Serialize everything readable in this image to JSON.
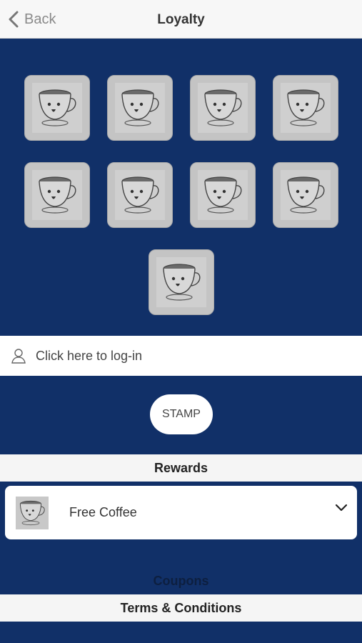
{
  "nav": {
    "back_label": "Back",
    "title": "Loyalty"
  },
  "stamps": {
    "count": 9,
    "icon": "coffee-cup-icon"
  },
  "login": {
    "text": "Click here to log-in",
    "icon": "user-icon"
  },
  "stamp_button": {
    "label": "STAMP"
  },
  "rewards": {
    "header": "Rewards",
    "items": [
      {
        "label": "Free Coffee",
        "icon": "coffee-cup-icon"
      }
    ]
  },
  "coupons": {
    "header": "Coupons"
  },
  "terms": {
    "header": "Terms & Conditions"
  },
  "colors": {
    "background": "#113068",
    "stamp_tile": "#c4c4c4",
    "bar": "#f5f5f5"
  }
}
